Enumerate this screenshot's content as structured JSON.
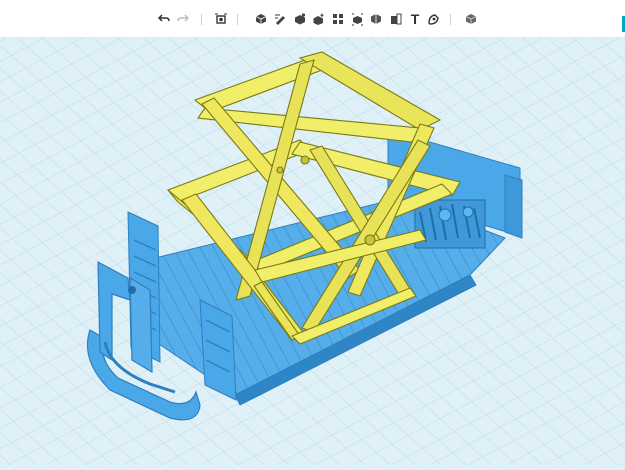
{
  "toolbar": {
    "undo_icon": "undo-arrow-icon",
    "redo_icon": "redo-arrow-icon",
    "text_tool_label": "T"
  },
  "colors": {
    "viewport_bg": "#dff0f7",
    "grid_line": "#b8dbe8",
    "model_blue": "#4aa8e8",
    "model_blue_dark": "#2e7fbf",
    "model_yellow": "#f1ee6a",
    "model_yellow_dark": "#8a8a1e",
    "accent": "#00a7c8"
  }
}
